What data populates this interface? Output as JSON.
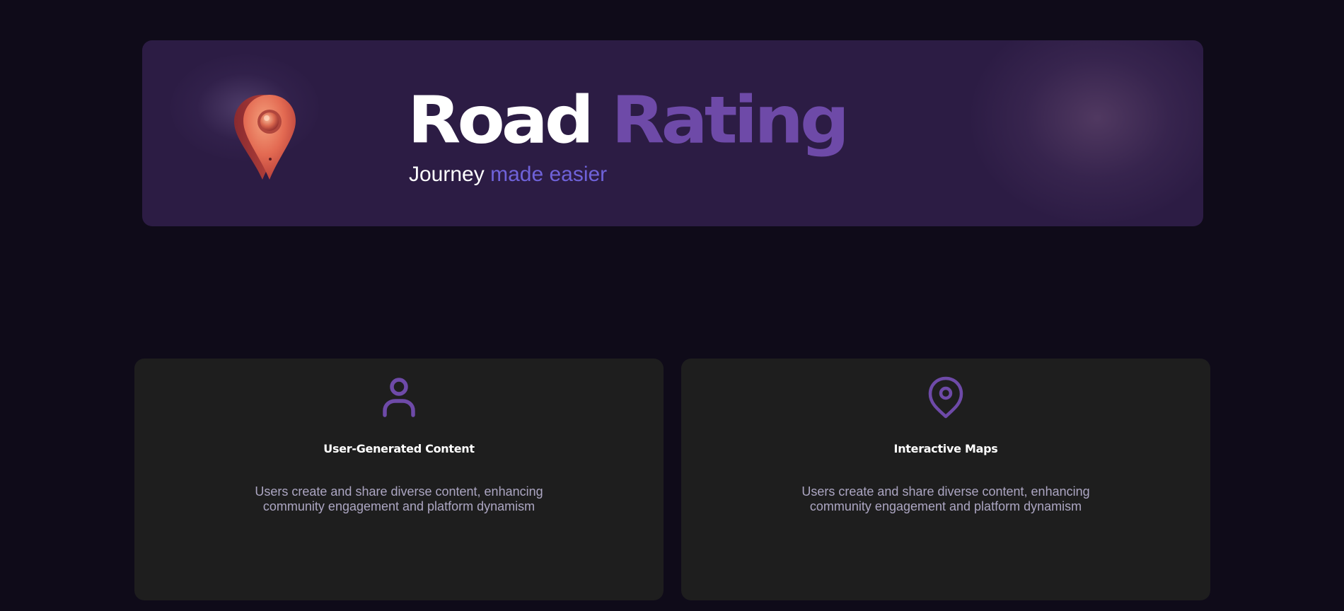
{
  "hero": {
    "title_part1": "Road",
    "title_part2": "Rating",
    "subtitle_part1": "Journey",
    "subtitle_part2": "made easier",
    "logo_icon": "map-pin-3d-icon"
  },
  "features": [
    {
      "icon": "user-icon",
      "title": "User-Generated Content",
      "description": "Users create and share diverse content, enhancing community engagement and platform dynamism"
    },
    {
      "icon": "map-pin-icon",
      "title": "Interactive Maps",
      "description": "Users create and share diverse content, enhancing community engagement and platform dynamism"
    }
  ],
  "colors": {
    "page_background": "#0f0b19",
    "hero_background": "#2c1c44",
    "accent_purple": "#6e4aa8",
    "subtitle_accent": "#6f62d9",
    "card_background": "#1e1e1e",
    "card_text": "#aca6c2",
    "pin_orange": "#e0644f"
  }
}
